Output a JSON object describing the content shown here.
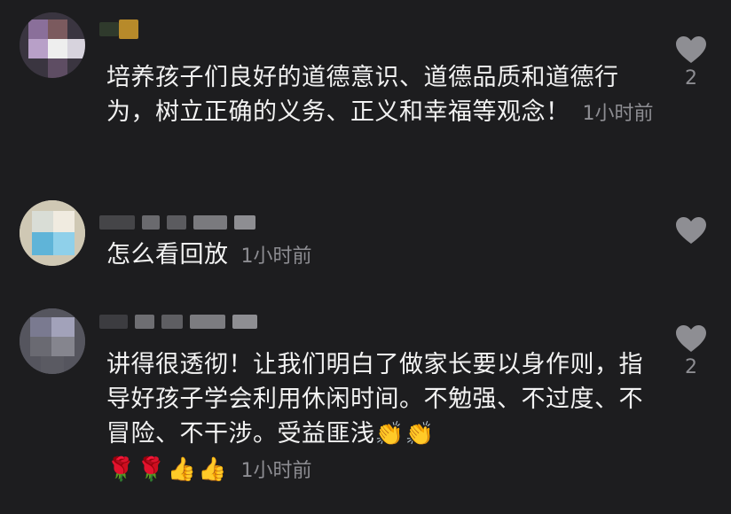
{
  "comments": [
    {
      "text": "培养孩子们良好的道德意识、道德品质和道德行为，树立正确的义务、正义和幸福等观念！",
      "time": "1小时前",
      "likes": "2"
    },
    {
      "text": "怎么看回放",
      "time": "1小时前",
      "likes": ""
    },
    {
      "text": "讲得很透彻！让我们明白了做家长要以身作则，指导好孩子学会利用休闲时间。不勉强、不过度、不冒险、不干涉。受益匪浅",
      "emoji_inline": "👏👏",
      "emoji_line": "🌹🌹👍👍",
      "time": "1小时前",
      "likes": "2"
    }
  ],
  "icons": {
    "like": "heart-icon"
  },
  "colors": {
    "background": "#1d1d1f",
    "text": "#f2f2f2",
    "muted": "#8d8d92"
  }
}
